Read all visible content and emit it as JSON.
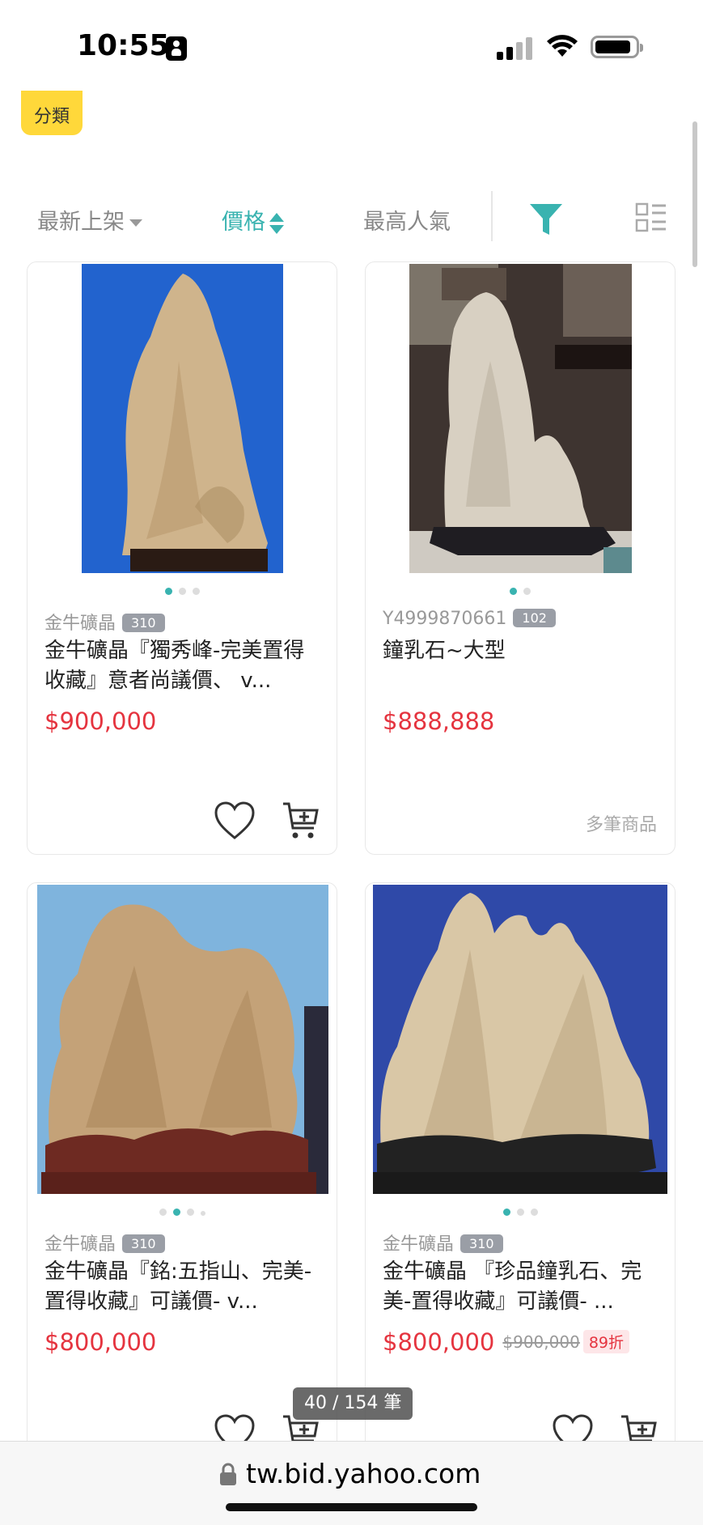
{
  "status_bar": {
    "time": "10:55"
  },
  "category_tag": {
    "label": "分類"
  },
  "sort_bar": {
    "newest": "最新上架",
    "price": "價格",
    "popular": "最高人氣",
    "active": "price"
  },
  "colors": {
    "accent": "#39b3b0",
    "price": "#e5343f",
    "tag": "#ffd83a"
  },
  "products": [
    {
      "seller": "金牛礦晶",
      "rating": "310",
      "title": "金牛礦晶『獨秀峰-完美置得收藏』意者尚議價、 v...",
      "price": "$900,000",
      "image_dots": 3,
      "active_dot": 0
    },
    {
      "seller": "Y4999870661",
      "rating": "102",
      "title": "鐘乳石~大型",
      "price": "$888,888",
      "multi_label": "多筆商品",
      "image_dots": 2,
      "active_dot": 0
    },
    {
      "seller": "金牛礦晶",
      "rating": "310",
      "title": "金牛礦晶『銘:五指山、完美-置得收藏』可議價- v...",
      "price": "$800,000",
      "image_dots": 4,
      "active_dot": 1
    },
    {
      "seller": "金牛礦晶",
      "rating": "310",
      "title": "金牛礦晶 『珍品鐘乳石、完美-置得收藏』可議價- ...",
      "price": "$800,000",
      "original_price": "$900,000",
      "discount": "89折",
      "image_dots": 3,
      "active_dot": 0
    }
  ],
  "page_counter": "40 / 154 筆",
  "url_bar": {
    "domain": "tw.bid.yahoo.com"
  },
  "icons": [
    "person-icon",
    "signal-icon",
    "wifi-icon",
    "battery-icon",
    "sort-desc-icon",
    "sort-updown-icon",
    "filter-icon",
    "list-view-icon",
    "heart-icon",
    "add-to-cart-icon",
    "lock-icon"
  ]
}
